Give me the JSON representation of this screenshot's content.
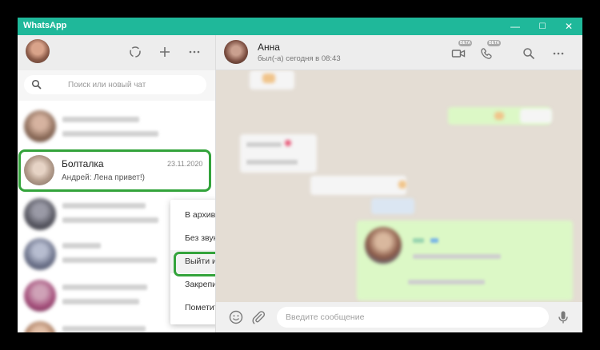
{
  "window": {
    "title": "WhatsApp",
    "controls": {
      "minimize": "—",
      "maximize": "☐",
      "close": "✕"
    }
  },
  "sidebar": {
    "header_icons": [
      "status-icon",
      "new-chat-icon",
      "menu-icon"
    ],
    "search": {
      "placeholder": "Поиск или новый чат"
    },
    "selected_chat": {
      "name": "Болталка",
      "date": "23.11.2020",
      "preview": "Андрей: Лена привет!)"
    }
  },
  "conversation": {
    "contact_name": "Анна",
    "contact_status": "был(-а) сегодня в 08:43",
    "beta_badge": "BETA",
    "header_icons": [
      "video-call-icon",
      "voice-call-icon",
      "search-icon",
      "menu-icon"
    ],
    "composer": {
      "placeholder": "Введите сообщение"
    }
  },
  "context_menu": {
    "items": [
      "В архив",
      "Без звука",
      "Выйти из группы",
      "Закрепить чат",
      "Пометить как непрочитанное"
    ],
    "highlighted_index": 2
  },
  "colors": {
    "titlebar": "#1fb89a",
    "highlight_outline": "#33a33b",
    "outgoing_bubble": "#dcf8c6",
    "chat_background": "#e4ddd4"
  }
}
